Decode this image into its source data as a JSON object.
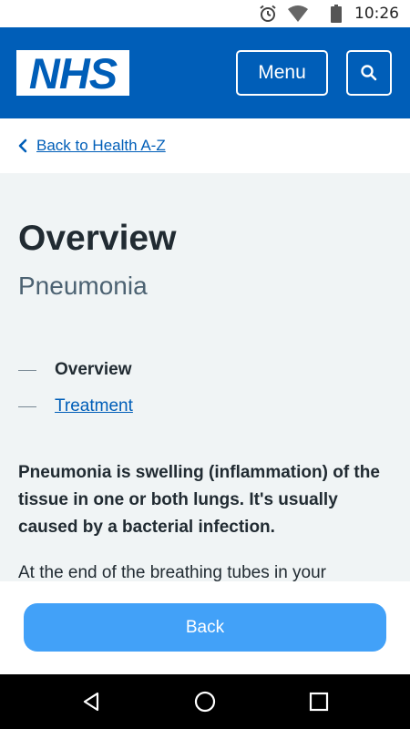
{
  "status_bar": {
    "time": "10:26",
    "icons": [
      "alarm-icon",
      "wifi-icon",
      "battery-icon"
    ]
  },
  "header": {
    "logo_text": "NHS",
    "menu_label": "Menu",
    "search_icon": "search-icon",
    "brand_color": "#005eb8"
  },
  "breadcrumb": {
    "label": "Back to Health A-Z",
    "icon": "chevron-left-icon"
  },
  "page": {
    "title": "Overview",
    "subtitle": "Pneumonia",
    "contents": [
      {
        "label": "Overview",
        "current": true
      },
      {
        "label": "Treatment",
        "current": false
      }
    ],
    "lead": "Pneumonia is swelling (inflammation) of the tissue in one or both lungs. It's usually caused by a bacterial infection.",
    "body": "At the end of the breathing tubes in your"
  },
  "footer": {
    "back_label": "Back",
    "button_color": "#42a1f8"
  },
  "nav_bar": {
    "buttons": [
      "back-triangle-icon",
      "home-circle-icon",
      "recents-square-icon"
    ]
  }
}
